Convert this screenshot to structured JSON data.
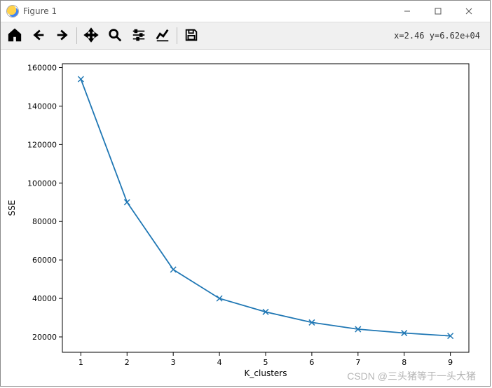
{
  "window": {
    "title": "Figure 1"
  },
  "toolbar": {
    "coords": "x=2.46 y=6.62e+04"
  },
  "watermark": "CSDN @三头猪等于一头大猪",
  "chart_data": {
    "type": "line",
    "x": [
      1,
      2,
      3,
      4,
      5,
      6,
      7,
      8,
      9
    ],
    "y": [
      154000,
      90000,
      55000,
      40000,
      33000,
      27500,
      24000,
      22000,
      20500
    ],
    "marker": "x",
    "line_color": "#1f77b4",
    "xlabel": "K_clusters",
    "ylabel": "SSE",
    "title": "",
    "xlim": [
      0.6,
      9.4
    ],
    "ylim": [
      12000,
      162000
    ],
    "xticks": [
      1,
      2,
      3,
      4,
      5,
      6,
      7,
      8,
      9
    ],
    "yticks": [
      20000,
      40000,
      60000,
      80000,
      100000,
      120000,
      140000,
      160000
    ]
  }
}
